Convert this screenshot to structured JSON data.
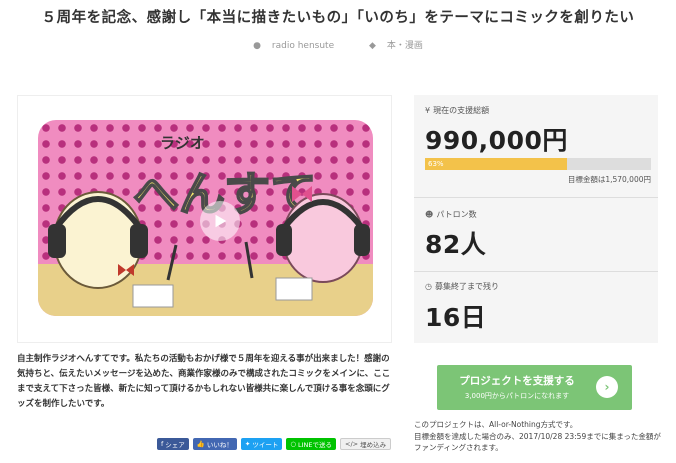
{
  "header": {
    "title": "５周年を記念、感謝し「本当に描きたいもの」「いのち」をテーマにコミックを創りたい",
    "author": "radio hensute",
    "category": "本・漫画"
  },
  "video": {
    "logo_small": "ラジオ",
    "logo_large": "へんすて"
  },
  "funding": {
    "raised_label": "現在の支援総額",
    "raised_amount": "990,000円",
    "progress_text": "63%",
    "progress_value": 0.63,
    "goal_text": "目標金額は1,570,000円",
    "patrons_label": "パトロン数",
    "patrons_value": "82人",
    "remaining_label": "募集終了まで残り",
    "remaining_value": "16日"
  },
  "description": {
    "text": "自主制作ラジオへんすてです。私たちの活動もおかげ様で５周年を迎える事が出来ました！感謝の気持ちと、伝えたいメッセージを込めた、商業作家様のみで構成されたコミックをメインに、ここまで支えて下さった皆様、新たに知って頂けるかもしれない皆様共に楽しんで頂ける事を念頭にグッズを制作したいです。"
  },
  "share": {
    "facebook": "シェア",
    "like": "いいね！",
    "tweet": "ツイート",
    "line": "LINEで送る",
    "embed": "埋め込み"
  },
  "cta": {
    "main": "プロジェクトを支援する",
    "sub": "3,000円からパトロンになれます"
  },
  "note": {
    "line1": "このプロジェクトは、All-or-Nothing方式です。",
    "line2": "目標金額を達成した場合のみ、2017/10/28 23:59までに集まった金額がファンディングされます。"
  },
  "colors": {
    "progress": "#f3c24a",
    "cta": "#7cc576"
  }
}
